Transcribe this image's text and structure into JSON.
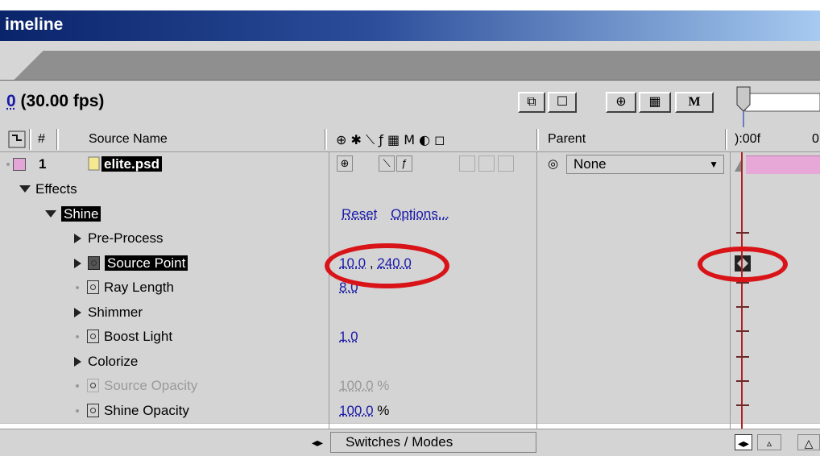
{
  "window": {
    "title": "imeline"
  },
  "toolbar": {
    "time_value": "0",
    "fps_label": "(30.00 fps)",
    "buttons": [
      "⧉",
      "☐",
      "⊕",
      "▦",
      "M"
    ]
  },
  "columns": {
    "source_name": "Source Name",
    "hash": "#",
    "parent": "Parent",
    "time_start": "):00f",
    "time_next": "0"
  },
  "layer": {
    "number": "1",
    "name": "elite.psd",
    "parent_value": "None"
  },
  "rows": [
    {
      "label": "Effects",
      "type": "group"
    },
    {
      "label": "Shine",
      "type": "effect",
      "value": "Reset   Options..."
    },
    {
      "label": "Pre-Process",
      "type": "sub"
    },
    {
      "label": "Source Point",
      "type": "prop",
      "value_a": "10.0",
      "value_b": "240.0",
      "selected": true
    },
    {
      "label": "Ray Length",
      "type": "prop",
      "value": "8.0"
    },
    {
      "label": "Shimmer",
      "type": "sub"
    },
    {
      "label": "Boost Light",
      "type": "prop",
      "value": "1.0"
    },
    {
      "label": "Colorize",
      "type": "sub"
    },
    {
      "label": "Source Opacity",
      "type": "prop",
      "value": "100.0",
      "unit": "%",
      "disabled": true
    },
    {
      "label": "Shine Opacity",
      "type": "prop",
      "value": "100.0",
      "unit": "%"
    }
  ],
  "effect_links": {
    "reset": "Reset",
    "options": "Options..."
  },
  "footer": {
    "switches_modes": "Switches / Modes"
  },
  "colors": {
    "accent_red": "#d81418",
    "layer_bar": "#e7a8d8",
    "title_blue": "#0a246a"
  }
}
